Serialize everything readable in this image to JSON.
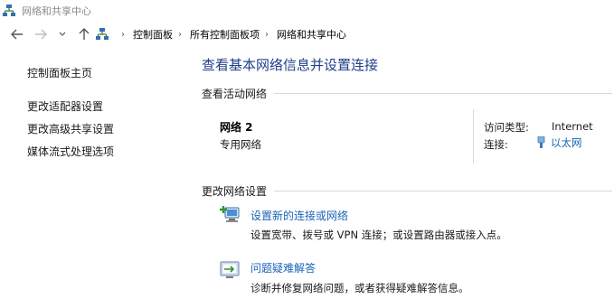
{
  "window": {
    "title": "网络和共享中心",
    "icon": "network-center-icon"
  },
  "nav": {
    "back_icon": "arrow-left-icon",
    "forward_icon": "arrow-right-icon",
    "recent_icon": "chevron-down-icon",
    "up_icon": "arrow-up-icon",
    "location_icon": "control-panel-icon",
    "breadcrumbs": [
      "控制面板",
      "所有控制面板项",
      "网络和共享中心"
    ]
  },
  "sidebar": {
    "home": "控制面板主页",
    "links": [
      "更改适配器设置",
      "更改高级共享设置",
      "媒体流式处理选项"
    ]
  },
  "main": {
    "title": "查看基本网络信息并设置连接",
    "active_networks": {
      "heading": "查看活动网络",
      "network_name": "网络 2",
      "network_type": "专用网络",
      "access_type_label": "访问类型:",
      "access_type_value": "Internet",
      "connection_label": "连接:",
      "connection_value": "以太网",
      "connection_icon": "ethernet-icon"
    },
    "change_settings": {
      "heading": "更改网络设置",
      "tasks": [
        {
          "icon": "new-connection-icon",
          "link": "设置新的连接或网络",
          "desc": "设置宽带、拨号或 VPN 连接；或设置路由器或接入点。"
        },
        {
          "icon": "troubleshoot-icon",
          "link": "问题疑难解答",
          "desc": "诊断并修复网络问题，或者获得疑难解答信息。"
        }
      ]
    }
  },
  "colors": {
    "link": "#1a64b8",
    "title": "#1e3f8a",
    "divider": "#d8d8d8"
  }
}
